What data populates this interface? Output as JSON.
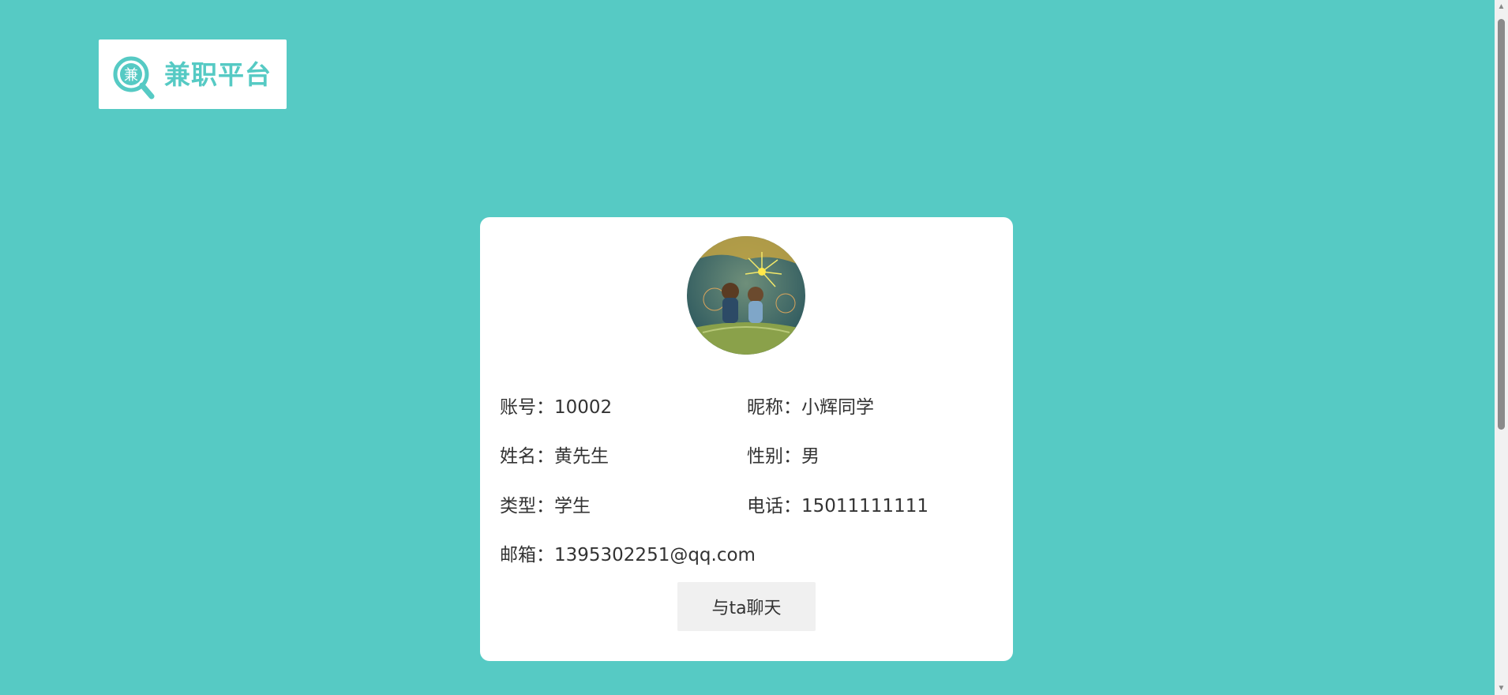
{
  "brand": {
    "name": "兼职平台",
    "mark_char": "兼",
    "icon": "magnifier-logo-icon",
    "color": "#56cac4"
  },
  "profile": {
    "avatar_icon": "avatar-fireworks-illustration",
    "rows": [
      {
        "label": "账号：",
        "value": "10002"
      },
      {
        "label": "昵称：",
        "value": "小辉同学"
      },
      {
        "label": "姓名：",
        "value": "黄先生"
      },
      {
        "label": "性别：",
        "value": "男"
      },
      {
        "label": "类型：",
        "value": "学生"
      },
      {
        "label": "电话：",
        "value": "15011111111"
      },
      {
        "label": "邮箱：",
        "value": "1395302251@qq.com"
      }
    ],
    "chat_button": "与ta聊天"
  },
  "colors": {
    "background": "#56cac4",
    "card": "#ffffff",
    "button": "#f0f0f0",
    "text": "#333333"
  }
}
